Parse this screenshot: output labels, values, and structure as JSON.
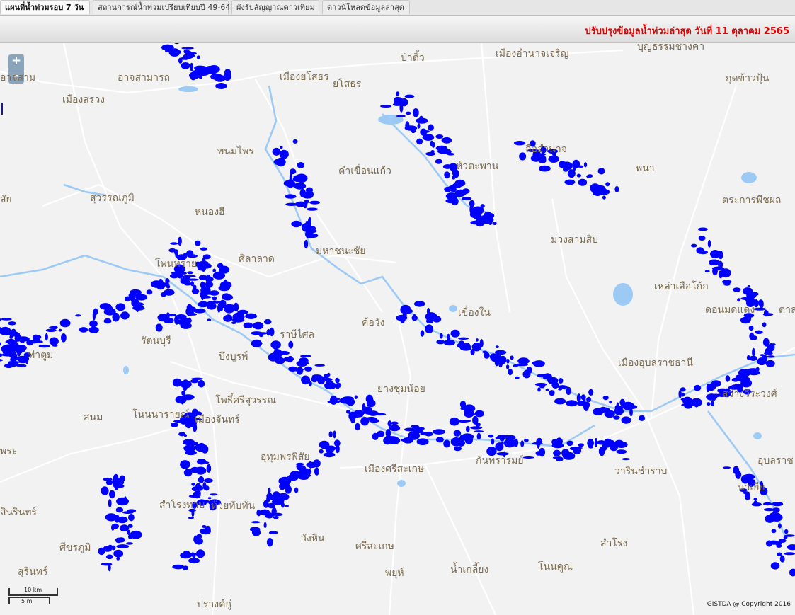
{
  "tabs": [
    {
      "label": "แผนที่น้ำท่วมรอบ 7 วัน",
      "active": true
    },
    {
      "label": "สถานการณ์น้ำท่วมเปรียบเทียบปี 49-64",
      "active": false
    },
    {
      "label": "ผังรับสัญญาณดาวเทียม",
      "active": false
    },
    {
      "label": "ดาวน์โหลดข้อมูลล่าสุด",
      "active": false
    }
  ],
  "banner": {
    "update_text": "ปรับปรุงข้อมูลน้ำท่วมล่าสุด วันที่ 11 ตุลาคม 2565"
  },
  "map": {
    "zoom_in_label": "+",
    "zoom_out_label": "-",
    "scale_km_label": "10 km",
    "scale_mi_label": "5 mi",
    "copyright": "GISTDA @ Copyright 2016",
    "colors": {
      "flood": "#0000ff",
      "water": "#9ccaf5",
      "road": "#ffffff",
      "background": "#f2f2f2",
      "label": "#7a6a4e"
    },
    "places": [
      "บุญธรรมช่างค่า",
      "ป่าติ้ว",
      "เมืองอำนาจเจริญ",
      "อาจสามารถ",
      "เมืองยโสธร",
      "ยโสธร",
      "กุดข้าวปุ้น",
      "เมืองสรวง",
      "พนมไพร",
      "ลืออำนาจ",
      "หัวตะพาน",
      "คำเขื่อนแก้ว",
      "พนา",
      "สุวรรณภูมิ",
      "ตระการพืชผล",
      "หนองฮี",
      "ม่วงสามสิบ",
      "ศิลาลาด",
      "มหาชนะชัย",
      "โพนทราย",
      "เหล่าเสือโก้ก",
      "เขื่องใน",
      "ดอนมดแดง",
      "ค้อวัง",
      "ราษีไศล",
      "รัตนบุรี",
      "ท่าตูม",
      "บึงบูรพ์",
      "เมืองอุบลราชธานี",
      "ยางชุมน้อย",
      "สว่างวีระวงศ์",
      "โพธิ์ศรีสุวรรณ",
      "สนม",
      "โนนนารายณ์",
      "เมืองจันทร์",
      "อุทุมพรพิสัย",
      "กันทรารมย์",
      "เมืองศรีสะเกษ",
      "วารินชำราบ",
      "นาเยีย",
      "สำโรงทาบ",
      "ห้วยทับทัน",
      "สินรินทร์",
      "วังหิน",
      "ศรีสะเกษ",
      "สำโรง",
      "ศีขรภูมิ",
      "พยุห์",
      "น้ำเกลี้ยง",
      "โนนคูณ",
      "สุรินทร์",
      "ปรางค์กู่",
      "อาจสาม",
      "สัย",
      "พระ",
      "ตาล",
      "อุบลราช"
    ]
  }
}
